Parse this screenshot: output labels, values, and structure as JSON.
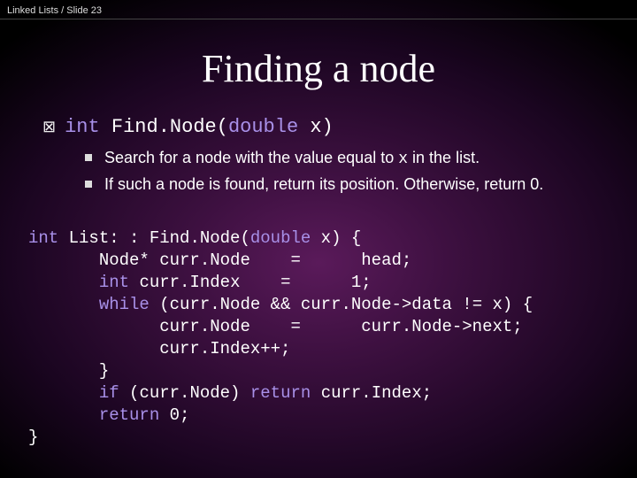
{
  "header": {
    "breadcrumb": "Linked Lists / Slide 23"
  },
  "title": "Finding a node",
  "signature": {
    "ret": "int",
    "name": " Find.Node(",
    "param_kw": "double",
    "tail": " x)"
  },
  "bullets": {
    "b1_pre": "Search for a node with the value equal to ",
    "b1_code": "x",
    "b1_post": " in the list.",
    "b2": "If such a node is found, return its position. Otherwise, return 0."
  },
  "code": {
    "l1a": "int",
    "l1b": " List: : Find.Node(",
    "l1c": "double",
    "l1d": " x) {",
    "l2": "       Node* curr.Node    =      head;",
    "l3a": "       ",
    "l3b": "int",
    "l3c": " curr.Index    =      1;",
    "l4a": "       ",
    "l4b": "while",
    "l4c": " (curr.Node && curr.Node->data != x) {",
    "l5": "             curr.Node    =      curr.Node->next;",
    "l6": "             curr.Index++;",
    "l7": "       }",
    "l8a": "       ",
    "l8b": "if",
    "l8c": " (curr.Node) ",
    "l8d": "return",
    "l8e": " curr.Index;",
    "l9a": "       ",
    "l9b": "return",
    "l9c": " 0;",
    "l10": "}"
  }
}
